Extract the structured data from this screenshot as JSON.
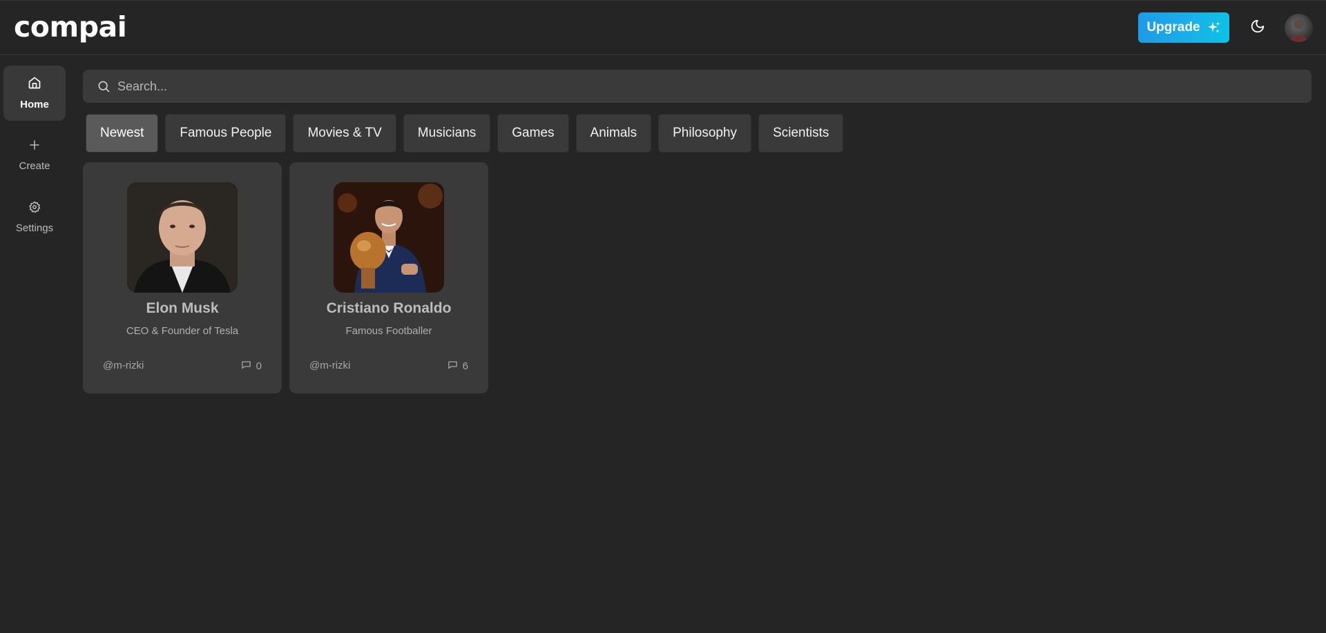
{
  "app": {
    "logo_text": "compai"
  },
  "header": {
    "upgrade_label": "Upgrade",
    "upgrade_icon": "sparkles-icon",
    "theme_icon": "moon-icon",
    "colors": {
      "upgrade_start": "#1e9be6",
      "upgrade_end": "#0ec2e6",
      "background": "#252525"
    }
  },
  "sidebar": {
    "items": [
      {
        "label": "Home",
        "icon": "home-icon",
        "active": true
      },
      {
        "label": "Create",
        "icon": "plus-icon",
        "active": false
      },
      {
        "label": "Settings",
        "icon": "gear-icon",
        "active": false
      }
    ]
  },
  "search": {
    "placeholder": "Search...",
    "value": ""
  },
  "categories": [
    {
      "label": "Newest",
      "active": true
    },
    {
      "label": "Famous People",
      "active": false
    },
    {
      "label": "Movies & TV",
      "active": false
    },
    {
      "label": "Musicians",
      "active": false
    },
    {
      "label": "Games",
      "active": false
    },
    {
      "label": "Animals",
      "active": false
    },
    {
      "label": "Philosophy",
      "active": false
    },
    {
      "label": "Scientists",
      "active": false
    }
  ],
  "companions": [
    {
      "name": "Elon Musk",
      "description": "CEO & Founder of Tesla",
      "handle": "@m-rizki",
      "comment_count": "0"
    },
    {
      "name": "Cristiano Ronaldo",
      "description": "Famous Footballer",
      "handle": "@m-rizki",
      "comment_count": "6"
    }
  ]
}
